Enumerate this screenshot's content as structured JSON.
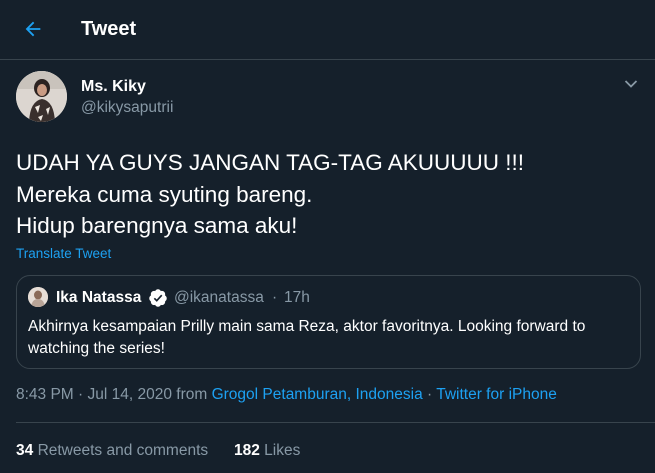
{
  "header": {
    "title": "Tweet",
    "back_icon": "arrow-left-icon"
  },
  "colors": {
    "background": "#15202b",
    "accent": "#1da1f2",
    "secondary_text": "#8899a6",
    "border": "#38444d"
  },
  "tweet": {
    "display_name": "Ms. Kiky",
    "handle": "@kikysaputrii",
    "lines": [
      "UDAH YA GUYS JANGAN TAG-TAG AKUUUUU !!!",
      "Mereka cuma syuting bareng.",
      "Hidup barengnya sama aku!"
    ],
    "translate_label": "Translate Tweet"
  },
  "quote": {
    "display_name": "Ika Natassa",
    "handle": "@ikanatassa",
    "separator": "·",
    "time": "17h",
    "text": "Akhirnya kesampaian Prilly main sama Reza, aktor favoritnya. Looking forward to watching the series!"
  },
  "meta": {
    "time_date": "8:43 PM · Jul 14, 2020",
    "from_label": "from",
    "location": "Grogol Petamburan, Indonesia",
    "separator": "·",
    "source": "Twitter for iPhone"
  },
  "stats": {
    "retweets_count": "34",
    "retweets_label": "Retweets and comments",
    "likes_count": "182",
    "likes_label": "Likes"
  }
}
